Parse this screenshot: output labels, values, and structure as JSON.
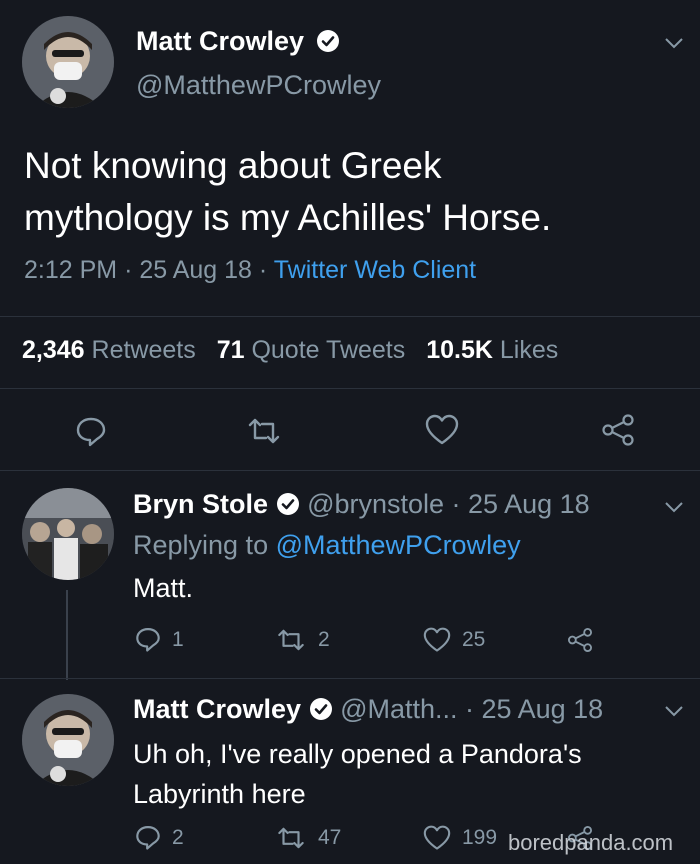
{
  "main_tweet": {
    "display_name": "Matt Crowley",
    "handle": "@MatthewPCrowley",
    "text_line1": "Not knowing about Greek",
    "text_line2": "mythology is my Achilles' Horse.",
    "time": "2:12 PM",
    "date": "25 Aug 18",
    "client": "Twitter Web Client",
    "dot": "·",
    "stats": {
      "retweets_num": "2,346",
      "retweets_lbl": "Retweets",
      "quotes_num": "71",
      "quotes_lbl": "Quote Tweets",
      "likes_num": "10.5K",
      "likes_lbl": "Likes"
    }
  },
  "reply1": {
    "display_name": "Bryn Stole",
    "handle": "@brynstole",
    "dot_date": "· 25 Aug 18",
    "replying_prefix": "Replying to",
    "replying_handle": "@MatthewPCrowley",
    "text": "Matt.",
    "replies": "1",
    "retweets": "2",
    "likes": "25"
  },
  "reply2": {
    "display_name": "Matt Crowley",
    "handle": "@Matth...",
    "dot_date": "· 25 Aug 18",
    "text_line1": "Uh oh, I've really opened a Pandora's",
    "text_line2": "Labyrinth here",
    "replies": "2",
    "retweets": "47",
    "likes": "199"
  },
  "watermark": "boredpanda.com",
  "colors": {
    "background": "#15181f",
    "muted": "#8899a6",
    "link": "#3fa0ee",
    "text": "#ffffff"
  },
  "icons": [
    "verified-badge-icon",
    "chevron-down-icon",
    "reply-icon",
    "retweet-icon",
    "like-icon",
    "share-icon"
  ]
}
